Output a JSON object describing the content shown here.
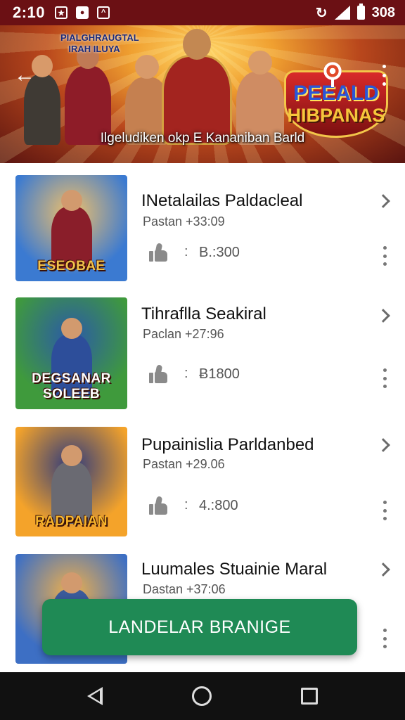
{
  "status_bar": {
    "time": "2:10",
    "icons_left": [
      "photo-icon",
      "record-icon",
      "app-icon"
    ],
    "battery_text": "308"
  },
  "banner": {
    "logo_left": "PIALGHRAUGTAL IRAH ILUYA",
    "logo_right_line1": "PEEALD",
    "logo_right_line2": "HIBPANAS",
    "caption": "Ilgeludiken okp E Kananiban Barld"
  },
  "items": [
    {
      "title": "INetalailas Paldacleal",
      "subtitle": "Pastan +33:09",
      "count": "B.:300",
      "thumb_label": "ESEOBAE",
      "thumb_colors": [
        "#3b7ad1",
        "#f0c06a"
      ],
      "figure_color": "#8a1e2a",
      "label_color": "#f2c24b"
    },
    {
      "title": "Tihraflla Seakiral",
      "subtitle": "Paclan +27:96",
      "count": "Ƀ1800",
      "thumb_label": "DEGSANAR SOLEEB",
      "thumb_colors": [
        "#3f9a3c",
        "#2b5aa8"
      ],
      "figure_color": "#2d4e9a",
      "label_color": "#ffffff"
    },
    {
      "title": "Pupainislia Parldanbed",
      "subtitle": "Pastan +29.06",
      "count": "4.:800",
      "thumb_label": "RADPAIAN",
      "thumb_colors": [
        "#f4a32a",
        "#2e3a7c"
      ],
      "figure_color": "#6a6a72",
      "label_color": "#f7b52b"
    },
    {
      "title": "Luumales Stuainie Maral",
      "subtitle": "Dastan +37:06",
      "count": "",
      "thumb_label": "",
      "thumb_colors": [
        "#3d6fc4",
        "#f0b04b"
      ],
      "figure_color": "#3a5a9a",
      "label_color": "#ffffff"
    }
  ],
  "cta": {
    "label": "LANDELAR BRANIGE"
  }
}
